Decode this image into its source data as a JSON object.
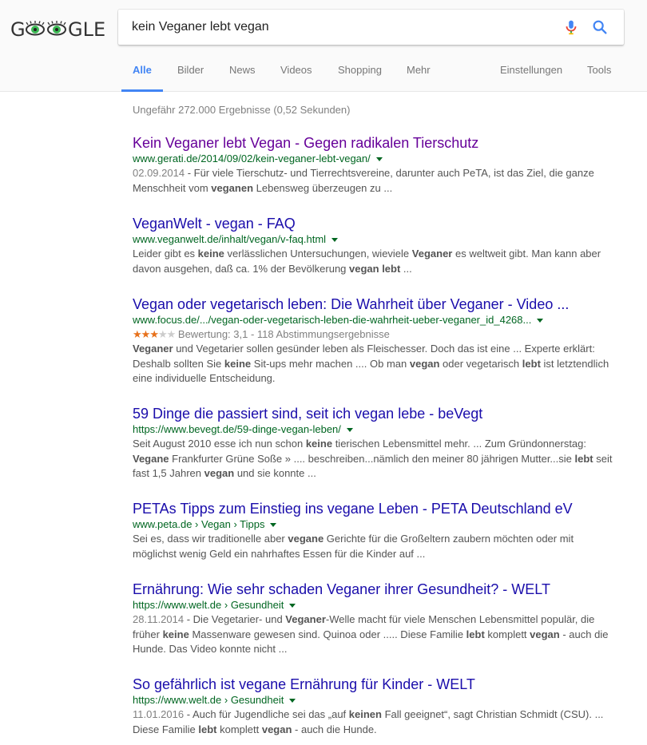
{
  "logo_text": "GOOGLE",
  "search": {
    "query": "kein Veganer lebt vegan"
  },
  "tabs": [
    {
      "label": "Alle",
      "active": true
    },
    {
      "label": "Bilder"
    },
    {
      "label": "News"
    },
    {
      "label": "Videos"
    },
    {
      "label": "Shopping"
    },
    {
      "label": "Mehr"
    },
    {
      "label": "Einstellungen"
    },
    {
      "label": "Tools"
    }
  ],
  "stats": "Ungefähr 272.000 Ergebnisse (0,52 Sekunden)",
  "colors": {
    "accent": "#4285f4",
    "link": "#1a0dab",
    "visited": "#660099",
    "url": "#006621",
    "snippet": "#545454",
    "star": "#e7711b"
  },
  "results": [
    {
      "title": "Kein Veganer lebt Vegan - Gegen radikalen Tierschutz",
      "url": "www.gerati.de/2014/09/02/kein-veganer-lebt-vegan/",
      "date": "02.09.2014",
      "snippet": [
        {
          "t": " - Für viele Tierschutz- und Tierrechtsvereine, darunter auch PeTA, ist das Ziel, die ganze Menschheit vom "
        },
        {
          "t": "veganen",
          "b": true
        },
        {
          "t": " Lebensweg überzeugen zu ..."
        }
      ]
    },
    {
      "title": "VeganWelt - vegan - FAQ",
      "url": "www.veganwelt.de/inhalt/vegan/v-faq.html",
      "snippet": [
        {
          "t": "Leider gibt es "
        },
        {
          "t": "keine",
          "b": true
        },
        {
          "t": " verlässlichen Untersuchungen, wieviele "
        },
        {
          "t": "Veganer",
          "b": true
        },
        {
          "t": " es weltweit gibt. Man kann aber davon ausgehen, daß ca. 1% der Bevölkerung "
        },
        {
          "t": "vegan lebt",
          "b": true
        },
        {
          "t": " ..."
        }
      ]
    },
    {
      "title": "Vegan oder vegetarisch leben: Die Wahrheit über Veganer - Video ...",
      "url": "www.focus.de/.../vegan-oder-vegetarisch-leben-die-wahrheit-ueber-veganer_id_4268...",
      "rating": {
        "value": 3.1,
        "max": 5,
        "text": "Bewertung: 3,1 - 118 Abstimmungsergebnisse"
      },
      "snippet": [
        {
          "t": "Veganer",
          "b": true
        },
        {
          "t": " und Vegetarier sollen gesünder leben als Fleischesser. Doch das ist eine ... Experte erklärt: Deshalb sollten Sie "
        },
        {
          "t": "keine",
          "b": true
        },
        {
          "t": " Sit-ups mehr machen .... Ob man "
        },
        {
          "t": "vegan",
          "b": true
        },
        {
          "t": " oder vegetarisch "
        },
        {
          "t": "lebt",
          "b": true
        },
        {
          "t": " ist letztendlich eine individuelle Entscheidung."
        }
      ]
    },
    {
      "title": "59 Dinge die passiert sind, seit ich vegan lebe - beVegt",
      "url": "https://www.bevegt.de/59-dinge-vegan-leben/",
      "snippet": [
        {
          "t": "Seit August 2010 esse ich nun schon "
        },
        {
          "t": "keine",
          "b": true
        },
        {
          "t": " tierischen Lebensmittel mehr. ... Zum Gründonnerstag: "
        },
        {
          "t": "Vegane",
          "b": true
        },
        {
          "t": " Frankfurter Grüne Soße » .... beschreiben...nämlich den meiner 80 jährigen Mutter...sie "
        },
        {
          "t": "lebt",
          "b": true
        },
        {
          "t": " seit fast 1,5 Jahren "
        },
        {
          "t": "vegan",
          "b": true
        },
        {
          "t": " und sie konnte ..."
        }
      ]
    },
    {
      "title": "PETAs Tipps zum Einstieg ins vegane Leben - PETA Deutschland eV",
      "url": "www.peta.de › Vegan › Tipps",
      "snippet": [
        {
          "t": "Sei es, dass wir traditionelle aber "
        },
        {
          "t": "vegane",
          "b": true
        },
        {
          "t": " Gerichte für die Großeltern zaubern möchten oder mit möglichst wenig Geld ein nahrhaftes Essen für die Kinder auf ..."
        }
      ]
    },
    {
      "title": "Ernährung: Wie sehr schaden Veganer ihrer Gesundheit? - WELT",
      "url": "https://www.welt.de › Gesundheit",
      "date": "28.11.2014",
      "snippet": [
        {
          "t": " - Die Vegetarier- und "
        },
        {
          "t": "Veganer",
          "b": true
        },
        {
          "t": "-Welle macht für viele Menschen Lebensmittel populär, die früher "
        },
        {
          "t": "keine",
          "b": true
        },
        {
          "t": " Massenware gewesen sind. Quinoa oder ..... Diese Familie "
        },
        {
          "t": "lebt",
          "b": true
        },
        {
          "t": " komplett "
        },
        {
          "t": "vegan",
          "b": true
        },
        {
          "t": " - auch die Hunde. Das Video konnte nicht ..."
        }
      ]
    },
    {
      "title": "So gefährlich ist vegane Ernährung für Kinder - WELT",
      "url": "https://www.welt.de › Gesundheit",
      "date": "11.01.2016",
      "snippet": [
        {
          "t": " - Auch für Jugendliche sei das „auf "
        },
        {
          "t": "keinen",
          "b": true
        },
        {
          "t": " Fall geeignet“, sagt Christian Schmidt (CSU). ... Diese Familie "
        },
        {
          "t": "lebt",
          "b": true
        },
        {
          "t": " komplett "
        },
        {
          "t": "vegan",
          "b": true
        },
        {
          "t": " - auch die Hunde."
        }
      ]
    }
  ]
}
